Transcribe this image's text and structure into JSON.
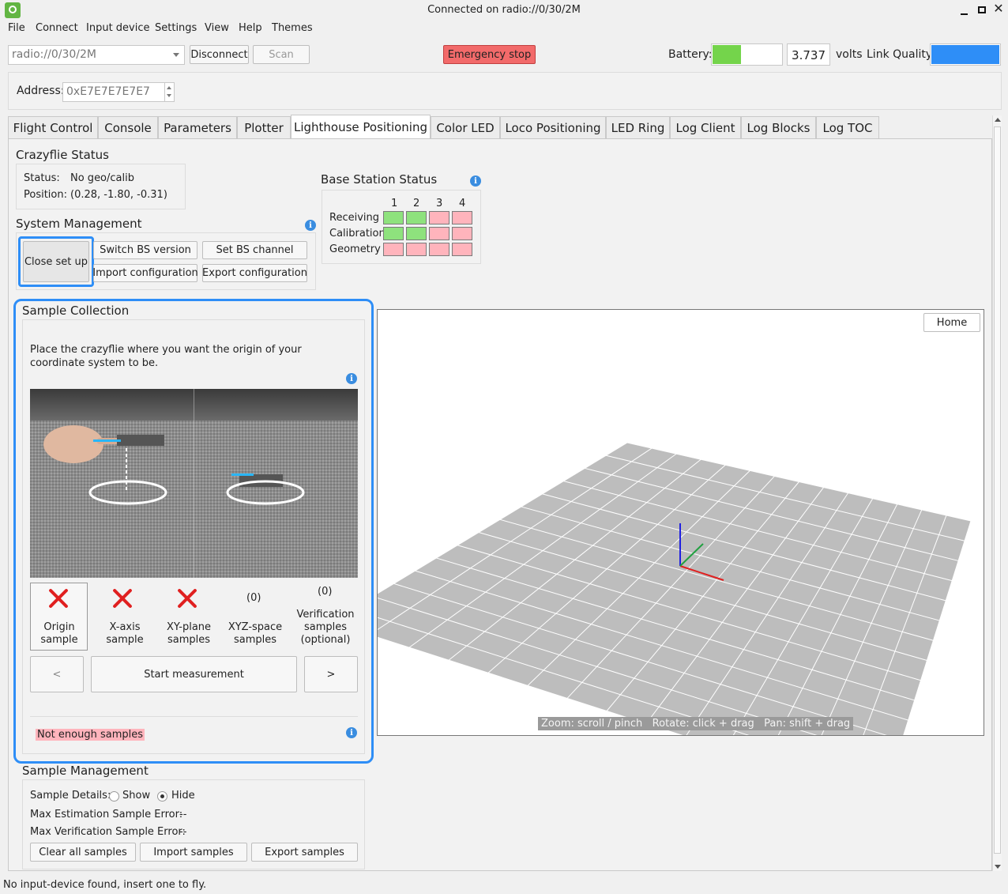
{
  "window": {
    "title": "Connected on radio://0/30/2M"
  },
  "menu": [
    "File",
    "Connect",
    "Input device",
    "Settings",
    "View",
    "Help",
    "Themes"
  ],
  "toolbar": {
    "uri": "radio://0/30/2M",
    "disconnect": "Disconnect",
    "scan": "Scan",
    "emergency": "Emergency stop",
    "battery_label": "Battery:",
    "battery_level": 0.4,
    "voltage": "3.737",
    "volts": "volts",
    "link_label": "Link Quality:",
    "link_level": 1.0
  },
  "address": {
    "label": "Address:",
    "value": "0xE7E7E7E7E7"
  },
  "tabs": [
    "Flight Control",
    "Console",
    "Parameters",
    "Plotter",
    "Lighthouse Positioning",
    "Color LED",
    "Loco Positioning",
    "LED Ring",
    "Log Client",
    "Log Blocks",
    "Log TOC"
  ],
  "cf_status": {
    "title": "Crazyflie Status",
    "status_label": "Status:",
    "status_value": "No geo/calib",
    "position_label": "Position:",
    "position_value": "(0.28, -1.80, -0.31)"
  },
  "system_mgmt": {
    "title": "System Management",
    "close_setup": "Close set up",
    "switch_bs": "Switch BS version",
    "set_bs_channel": "Set BS channel",
    "import_config": "Import configuration",
    "export_config": "Export configuration"
  },
  "bs_status": {
    "title": "Base Station Status",
    "columns": [
      "1",
      "2",
      "3",
      "4"
    ],
    "rows": [
      {
        "label": "Receiving",
        "states": [
          "ok",
          "ok",
          "bad",
          "bad"
        ]
      },
      {
        "label": "Calibration",
        "states": [
          "ok",
          "ok",
          "bad",
          "bad"
        ]
      },
      {
        "label": "Geometry",
        "states": [
          "bad",
          "bad",
          "bad",
          "bad"
        ]
      }
    ]
  },
  "sample_collection": {
    "title": "Sample Collection",
    "instruction": "Place the crazyflie where you want the origin of your coordinate system to be.",
    "steps": [
      {
        "status": "x",
        "caption": "Origin sample"
      },
      {
        "status": "x",
        "caption": "X-axis sample"
      },
      {
        "status": "x",
        "caption": "XY-plane samples"
      },
      {
        "status": "(0)",
        "caption": "XYZ-space samples"
      },
      {
        "status": "(0)",
        "caption": "Verification samples (optional)"
      }
    ],
    "prev": "<",
    "start": "Start measurement",
    "next": ">",
    "warning": "Not enough samples"
  },
  "sample_mgmt": {
    "title": "Sample Management",
    "details_label": "Sample Details:",
    "show": "Show",
    "hide": "Hide",
    "max_est_label": "Max Estimation Sample Error:",
    "max_est_value": "--",
    "max_ver_label": "Max Verification Sample Error:",
    "max_ver_value": "--",
    "clear": "Clear all samples",
    "import": "Import samples",
    "export": "Export samples"
  },
  "viewer": {
    "home": "Home",
    "hint": "Zoom: scroll / pinch   Rotate: click + drag   Pan: shift + drag"
  },
  "statusbar": "No input-device found, insert one to fly.",
  "colors": {
    "accent": "#3a8de0",
    "ok": "#8ee27d",
    "bad": "#ffb4bc",
    "emergency": "#f26a6a"
  }
}
